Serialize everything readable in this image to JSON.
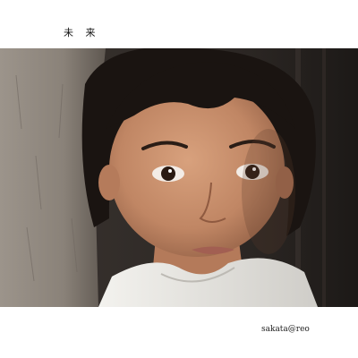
{
  "cover": {
    "title": "未 来",
    "credit": "sakata@reo"
  },
  "photo": {
    "subject": "portrait-photo",
    "colors": {
      "wall": "#8d857c",
      "background": "#2a2624",
      "hair": "#1a1411",
      "skin": "#c58d6b",
      "shirt": "#ecebe7"
    }
  }
}
